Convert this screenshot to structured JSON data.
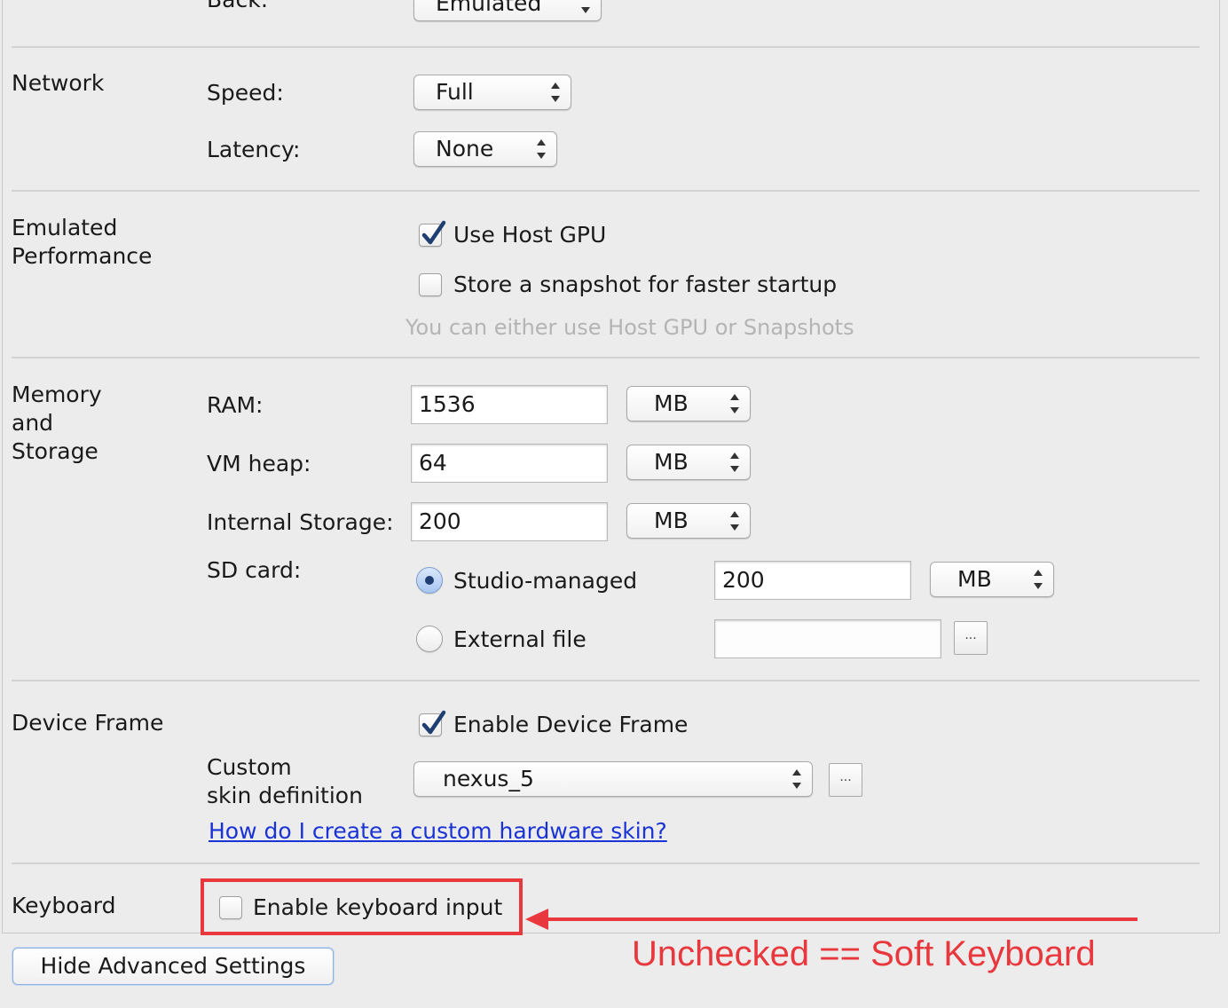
{
  "top_cutoff": {
    "label": "Back:",
    "select_value": "Emulated"
  },
  "network": {
    "section_label": "Network",
    "speed": {
      "label": "Speed:",
      "value": "Full"
    },
    "latency": {
      "label": "Latency:",
      "value": "None"
    }
  },
  "performance": {
    "section_label_line1": "Emulated",
    "section_label_line2": "Performance",
    "use_host_gpu": {
      "label": "Use Host GPU",
      "checked": true
    },
    "snapshot": {
      "label": "Store a snapshot for faster startup",
      "checked": false
    },
    "hint": "You can either use Host GPU or Snapshots"
  },
  "memory": {
    "section_label_line1": "Memory",
    "section_label_line2": "and",
    "section_label_line3": "Storage",
    "ram": {
      "label": "RAM:",
      "value": "1536",
      "unit": "MB"
    },
    "vm_heap": {
      "label": "VM heap:",
      "value": "64",
      "unit": "MB"
    },
    "internal_storage": {
      "label": "Internal Storage:",
      "value": "200",
      "unit": "MB"
    },
    "sd_card": {
      "label": "SD card:",
      "studio_managed": {
        "label": "Studio-managed",
        "selected": true,
        "value": "200",
        "unit": "MB"
      },
      "external_file": {
        "label": "External file",
        "selected": false,
        "value": "",
        "browse_label": "..."
      }
    }
  },
  "device_frame": {
    "section_label": "Device Frame",
    "enable": {
      "label": "Enable Device Frame",
      "checked": true
    },
    "custom_skin_label_line1": "Custom",
    "custom_skin_label_line2": "skin definition",
    "skin_value": "nexus_5",
    "browse_label": "...",
    "help_link": "How do I create a custom hardware skin?"
  },
  "keyboard": {
    "section_label": "Keyboard",
    "enable": {
      "label": "Enable keyboard input",
      "checked": false
    }
  },
  "hide_advanced_button": "Hide Advanced Settings",
  "annotation_text": "Unchecked == Soft Keyboard",
  "colors": {
    "annotation": "#e8383d",
    "link": "#1a33d6",
    "check": "#1f3f73"
  }
}
